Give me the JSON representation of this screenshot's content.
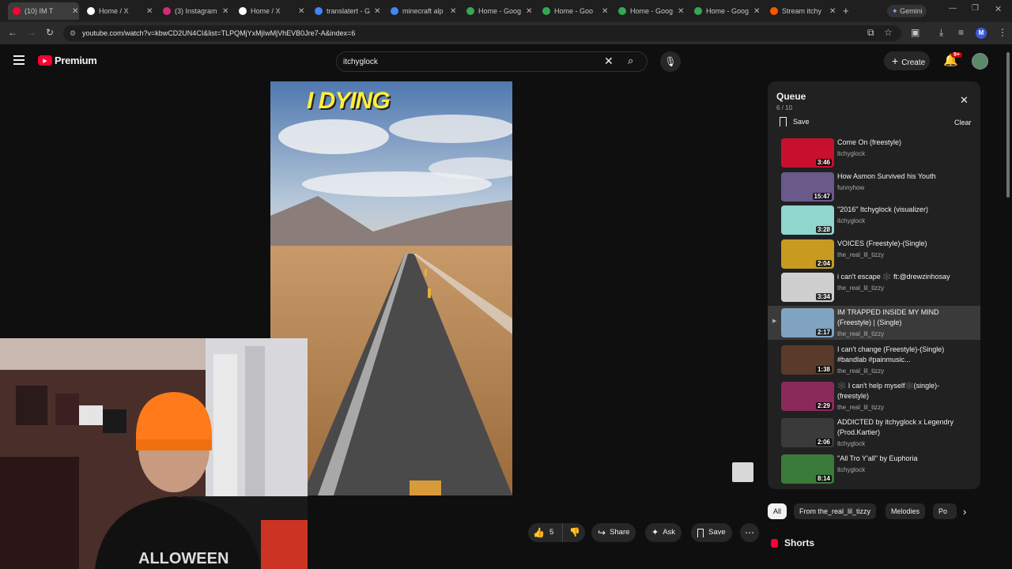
{
  "browser": {
    "tabs": [
      {
        "title": "(10) IM T",
        "icon": "youtube-icon",
        "color": "#ff0033"
      },
      {
        "title": "Home / X",
        "icon": "x-icon",
        "color": "#ffffff"
      },
      {
        "title": "(3) Instagram",
        "icon": "instagram-icon",
        "color": "#d62976"
      },
      {
        "title": "Home / X",
        "icon": "x-icon",
        "color": "#ffffff"
      },
      {
        "title": "translatert - G",
        "icon": "google-icon",
        "color": "#4285f4"
      },
      {
        "title": "minecraft alp",
        "icon": "google-icon",
        "color": "#4285f4"
      },
      {
        "title": "Home - Goog",
        "icon": "drive-icon",
        "color": "#34a853"
      },
      {
        "title": "Home - Goo",
        "icon": "drive-icon",
        "color": "#34a853"
      },
      {
        "title": "Home - Goog",
        "icon": "drive-icon",
        "color": "#34a853"
      },
      {
        "title": "Home - Goog",
        "icon": "drive-icon",
        "color": "#34a853"
      },
      {
        "title": "Stream itchy",
        "icon": "soundcloud-icon",
        "color": "#ff5500"
      }
    ],
    "gemini_label": "Gemini",
    "url": "youtube.com/watch?v=kbwCD2UN4CI&list=TLPQMjYxMjIwMjVhEVB0Jre7-A&index=6",
    "profile_initial": "M"
  },
  "youtube": {
    "logo_label": "Premium",
    "search_value": "itchyglock",
    "create_label": "Create",
    "notif_badge": "9+"
  },
  "video": {
    "overlay_text": "I DYING"
  },
  "queue": {
    "title": "Queue",
    "position": "6 / 10",
    "save_label": "Save",
    "clear_label": "Clear",
    "items": [
      {
        "title": "Come On (freestyle)",
        "artist": "itchyglock",
        "duration": "3:46",
        "thumb": "#c8102e"
      },
      {
        "title": "How Asmon Survived his Youth",
        "artist": "funnyhow",
        "duration": "15:47",
        "thumb": "#6a5a8a"
      },
      {
        "title": "\"2016\" Itchyglock (visualizer)",
        "artist": "itchyglock",
        "duration": "3:28",
        "thumb": "#8fd6cf"
      },
      {
        "title": "VOICES (Freestyle)-(Single)",
        "artist": "the_real_lil_tizzy",
        "duration": "2:04",
        "thumb": "#c89a20"
      },
      {
        "title": "i can't escape 🕸️ ft:@drewzinhosay",
        "artist": "the_real_lil_tizzy",
        "duration": "3:34",
        "thumb": "#cfcfcf"
      },
      {
        "title": "IM TRAPPED INSIDE MY MIND (Freestyle) | (Single)",
        "artist": "the_real_lil_tizzy",
        "duration": "2:17",
        "thumb": "#7fa3c0"
      },
      {
        "title": "I can't change (Freestyle)-(Single) #bandlab #painmusic...",
        "artist": "the_real_lil_tizzy",
        "duration": "1:38",
        "thumb": "#5a3a2a"
      },
      {
        "title": "🕸️ I can't help myself🕸️(single)-(freestyle)",
        "artist": "the_real_lil_tizzy",
        "duration": "2:29",
        "thumb": "#8a2a5a"
      },
      {
        "title": "ADDICTED by itchyglock x Legendry (Prod.Kartier)",
        "artist": "itchyglock",
        "duration": "2:06",
        "thumb": "#3a3a3a"
      },
      {
        "title": "\"All Tro Y'all\" by Euphoria",
        "artist": "itchyglock",
        "duration": "8:14",
        "thumb": "#3a7a3a"
      }
    ],
    "current_index": 5
  },
  "chips": [
    "All",
    "From the_real_lil_tizzy",
    "Melodies",
    "Po"
  ],
  "actions": {
    "like_count": "5",
    "share_label": "Share",
    "ask_label": "Ask",
    "save_label": "Save"
  },
  "shorts_label": "Shorts"
}
